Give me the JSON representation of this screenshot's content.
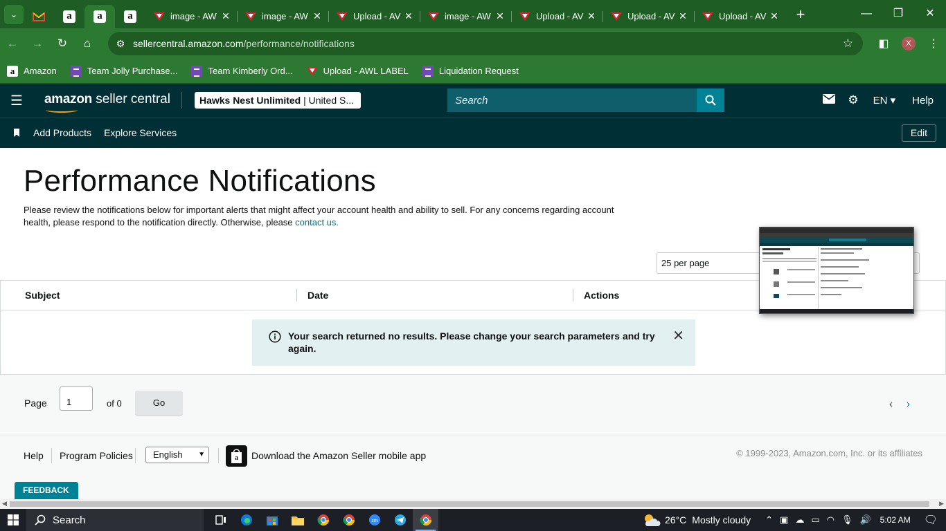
{
  "browser": {
    "tabs": [
      {
        "title": "image - AW"
      },
      {
        "title": "image - AW"
      },
      {
        "title": "Upload - AV"
      },
      {
        "title": "image - AW"
      },
      {
        "title": "Upload - AV"
      },
      {
        "title": "Upload - AV"
      },
      {
        "title": "Upload - AV"
      }
    ],
    "url_host": "sellercentral.amazon.com",
    "url_path": "/performance/notifications",
    "profile_initial": "X",
    "bookmarks": [
      {
        "label": "Amazon"
      },
      {
        "label": "Team Jolly Purchase..."
      },
      {
        "label": "Team Kimberly Ord..."
      },
      {
        "label": "Upload - AWL LABEL"
      },
      {
        "label": "Liquidation Request"
      }
    ]
  },
  "header": {
    "logo_brand": "amazon",
    "logo_suffix": " seller central",
    "store_name": "Hawks Nest Unlimited",
    "store_region": " | United S...",
    "search_placeholder": "Search",
    "language": "EN",
    "help": "Help"
  },
  "subnav": {
    "links": [
      "Add Products",
      "Explore Services"
    ],
    "edit": "Edit"
  },
  "main": {
    "title": "Performance Notifications",
    "intro": "Please review the notifications below for important alerts that might affect your account health and ability to sell. For any concerns regarding account health, please respond to the notification directly. Otherwise, please ",
    "contact_link": "contact us.",
    "per_page": "25 per page",
    "columns": [
      "Subject",
      "Date",
      "Actions"
    ],
    "alert_message": "Your search returned no results. Please change your search parameters and try again."
  },
  "pager": {
    "label": "Page",
    "current": "1",
    "of": "of 0",
    "go": "Go"
  },
  "footer": {
    "help": "Help",
    "policies": "Program Policies",
    "language": "English",
    "app": "Download the Amazon Seller mobile app",
    "copyright": "© 1999-2023, Amazon.com, Inc. or its affiliates",
    "feedback": "FEEDBACK"
  },
  "taskbar": {
    "search": "Search",
    "temperature": "26°C",
    "weather": "Mostly cloudy",
    "time": "5:02 AM"
  },
  "colors": {
    "browser_frame": "#1e5d23",
    "toolbar": "#2c7a32",
    "sc_header": "#002f36",
    "search_button": "#008296",
    "link": "#007185",
    "alert_bg": "#e2f0f2"
  }
}
